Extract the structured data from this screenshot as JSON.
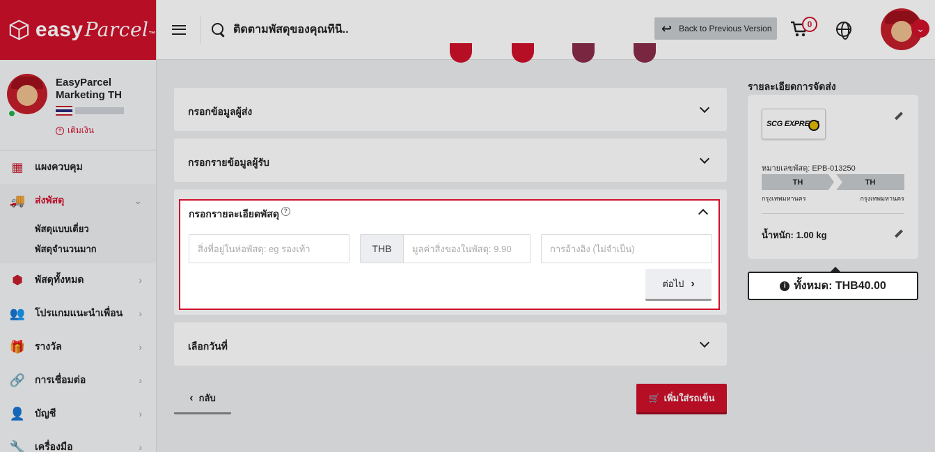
{
  "brand": {
    "name": "easy",
    "name2": "Parcel",
    "tm": "™"
  },
  "profile": {
    "name": "EasyParcel Marketing TH",
    "topup_label": "เติมเงิน"
  },
  "sidebar": {
    "items": [
      {
        "label": "แผงควบคุม",
        "icon": "dashboard-icon"
      },
      {
        "label": "ส่งพัสดุ",
        "icon": "truck-icon"
      },
      {
        "label": "พัสดุทั้งหมด",
        "icon": "boxes-icon"
      },
      {
        "label": "โปรแกมแนะนำเพื่อน",
        "icon": "referral-icon"
      },
      {
        "label": "รางวัล",
        "icon": "gift-icon"
      },
      {
        "label": "การเชื่อมต่อ",
        "icon": "link-icon"
      },
      {
        "label": "บัญชี",
        "icon": "user-icon"
      },
      {
        "label": "เครื่องมือ",
        "icon": "wrench-icon"
      }
    ],
    "subitems": [
      "พัสดุแบบเดี่ยว",
      "พัสดุจำนวนมาก"
    ]
  },
  "topbar": {
    "search_placeholder": "ติดตามพัสดุของคุณที่นี่..",
    "back_label": "Back to Previous Version",
    "cart_count": "0"
  },
  "form": {
    "sender_title": "กรอกข้อมูลผู้ส่ง",
    "receiver_title": "กรอกรายข้อมูลผู้รับ",
    "parcel_title": "กรอกรายละเอียดพัสดุ",
    "content_placeholder": "สิ่งที่อยู่ในห่อพัสดุ: eg รองเท้า",
    "currency": "THB",
    "value_placeholder": "มูลค่าสิ่งของในพัสดุ: 9.90",
    "reference_placeholder": "การอ้างอิง (ไม่จำเป็น)",
    "next_label": "ต่อไป",
    "date_title": "เลือกวันที่",
    "back_label": "กลับ",
    "add_cart_label": "เพิ่มใส่รถเข็น"
  },
  "summary": {
    "title": "รายละเอียดการจัดส่ง",
    "courier": "SCG EXPRESS",
    "tracking_label": "หมายเลขพัสดุ: EPB-013250",
    "from_country": "TH",
    "to_country": "TH",
    "from_city": "กรุงเทพมหานคร",
    "to_city": "กรุงเทพมหานคร",
    "weight_label": "น้ำหนัก:  1.00 kg",
    "total_label": "ทั้งหมด: THB40.00"
  },
  "colors": {
    "brand": "#d0102b",
    "background": "#eceef1"
  }
}
